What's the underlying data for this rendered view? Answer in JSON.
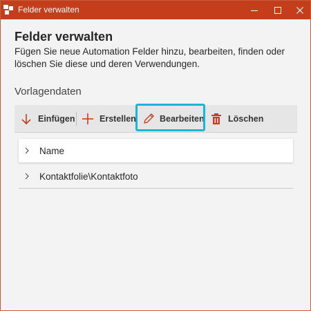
{
  "window": {
    "title": "Felder verwalten",
    "accent_color": "#c43e1c",
    "focus_color": "#1fb3d6"
  },
  "main": {
    "heading": "Felder verwalten",
    "description": "Fügen Sie neue Automation Felder hinzu, bearbeiten, finden oder löschen Sie diese und deren Verwendungen.",
    "section_title": "Vorlagendaten"
  },
  "toolbar": {
    "insert_label": "Einfügen",
    "create_label": "Erstellen",
    "edit_label": "Bearbeiten",
    "delete_label": "Löschen"
  },
  "tree": {
    "items": [
      {
        "label": "Name",
        "icon": "chevron-right-icon"
      },
      {
        "label": "Kontaktfolie\\Kontaktfoto",
        "icon": "chevron-right-icon"
      }
    ]
  }
}
